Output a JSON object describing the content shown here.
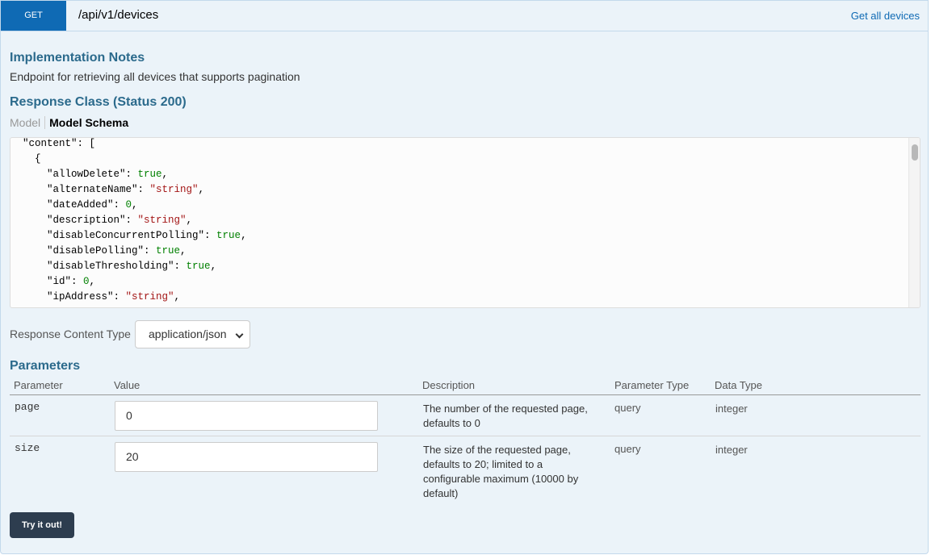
{
  "endpoint": {
    "method": "GET",
    "path": "/api/v1/devices",
    "summary": "Get all devices"
  },
  "implementation_notes": {
    "title": "Implementation Notes",
    "text": "Endpoint for retrieving all devices that supports pagination"
  },
  "response_class": {
    "title": "Response Class (Status 200)",
    "tabs": {
      "model": "Model",
      "schema": "Model Schema"
    },
    "schema_lines": [
      {
        "indent": "  ",
        "key": "\"content\"",
        "sep": ": ",
        "value": "[",
        "vtype": "k"
      },
      {
        "indent": "    ",
        "key": "",
        "sep": "",
        "value": "{",
        "vtype": "k"
      },
      {
        "indent": "      ",
        "key": "\"allowDelete\"",
        "sep": ": ",
        "value": "true",
        "vtype": "vb",
        "tail": ","
      },
      {
        "indent": "      ",
        "key": "\"alternateName\"",
        "sep": ": ",
        "value": "\"string\"",
        "vtype": "vs",
        "tail": ","
      },
      {
        "indent": "      ",
        "key": "\"dateAdded\"",
        "sep": ": ",
        "value": "0",
        "vtype": "vn",
        "tail": ","
      },
      {
        "indent": "      ",
        "key": "\"description\"",
        "sep": ": ",
        "value": "\"string\"",
        "vtype": "vs",
        "tail": ","
      },
      {
        "indent": "      ",
        "key": "\"disableConcurrentPolling\"",
        "sep": ": ",
        "value": "true",
        "vtype": "vb",
        "tail": ","
      },
      {
        "indent": "      ",
        "key": "\"disablePolling\"",
        "sep": ": ",
        "value": "true",
        "vtype": "vb",
        "tail": ","
      },
      {
        "indent": "      ",
        "key": "\"disableThresholding\"",
        "sep": ": ",
        "value": "true",
        "vtype": "vb",
        "tail": ","
      },
      {
        "indent": "      ",
        "key": "\"id\"",
        "sep": ": ",
        "value": "0",
        "vtype": "vn",
        "tail": ","
      },
      {
        "indent": "      ",
        "key": "\"ipAddress\"",
        "sep": ": ",
        "value": "\"string\"",
        "vtype": "vs",
        "tail": ","
      }
    ]
  },
  "response_content_type": {
    "label": "Response Content Type",
    "selected": "application/json"
  },
  "parameters": {
    "title": "Parameters",
    "headers": {
      "parameter": "Parameter",
      "value": "Value",
      "description": "Description",
      "parameter_type": "Parameter Type",
      "data_type": "Data Type"
    },
    "rows": [
      {
        "name": "page",
        "value": "0",
        "description": "The number of the requested page, defaults to 0",
        "parameter_type": "query",
        "data_type": "integer"
      },
      {
        "name": "size",
        "value": "20",
        "description": "The size of the requested page, defaults to 20; limited to a configurable maximum (10000 by default)",
        "parameter_type": "query",
        "data_type": "integer"
      }
    ]
  },
  "actions": {
    "try_label": "Try it out!"
  },
  "colors": {
    "method_bg": "#0f6ab4",
    "panel_bg": "#ebf3f9",
    "heading_text": "#2b6a8c",
    "button_bg": "#2d3d4f",
    "json_bool": "#008000",
    "json_string": "#a31515"
  }
}
